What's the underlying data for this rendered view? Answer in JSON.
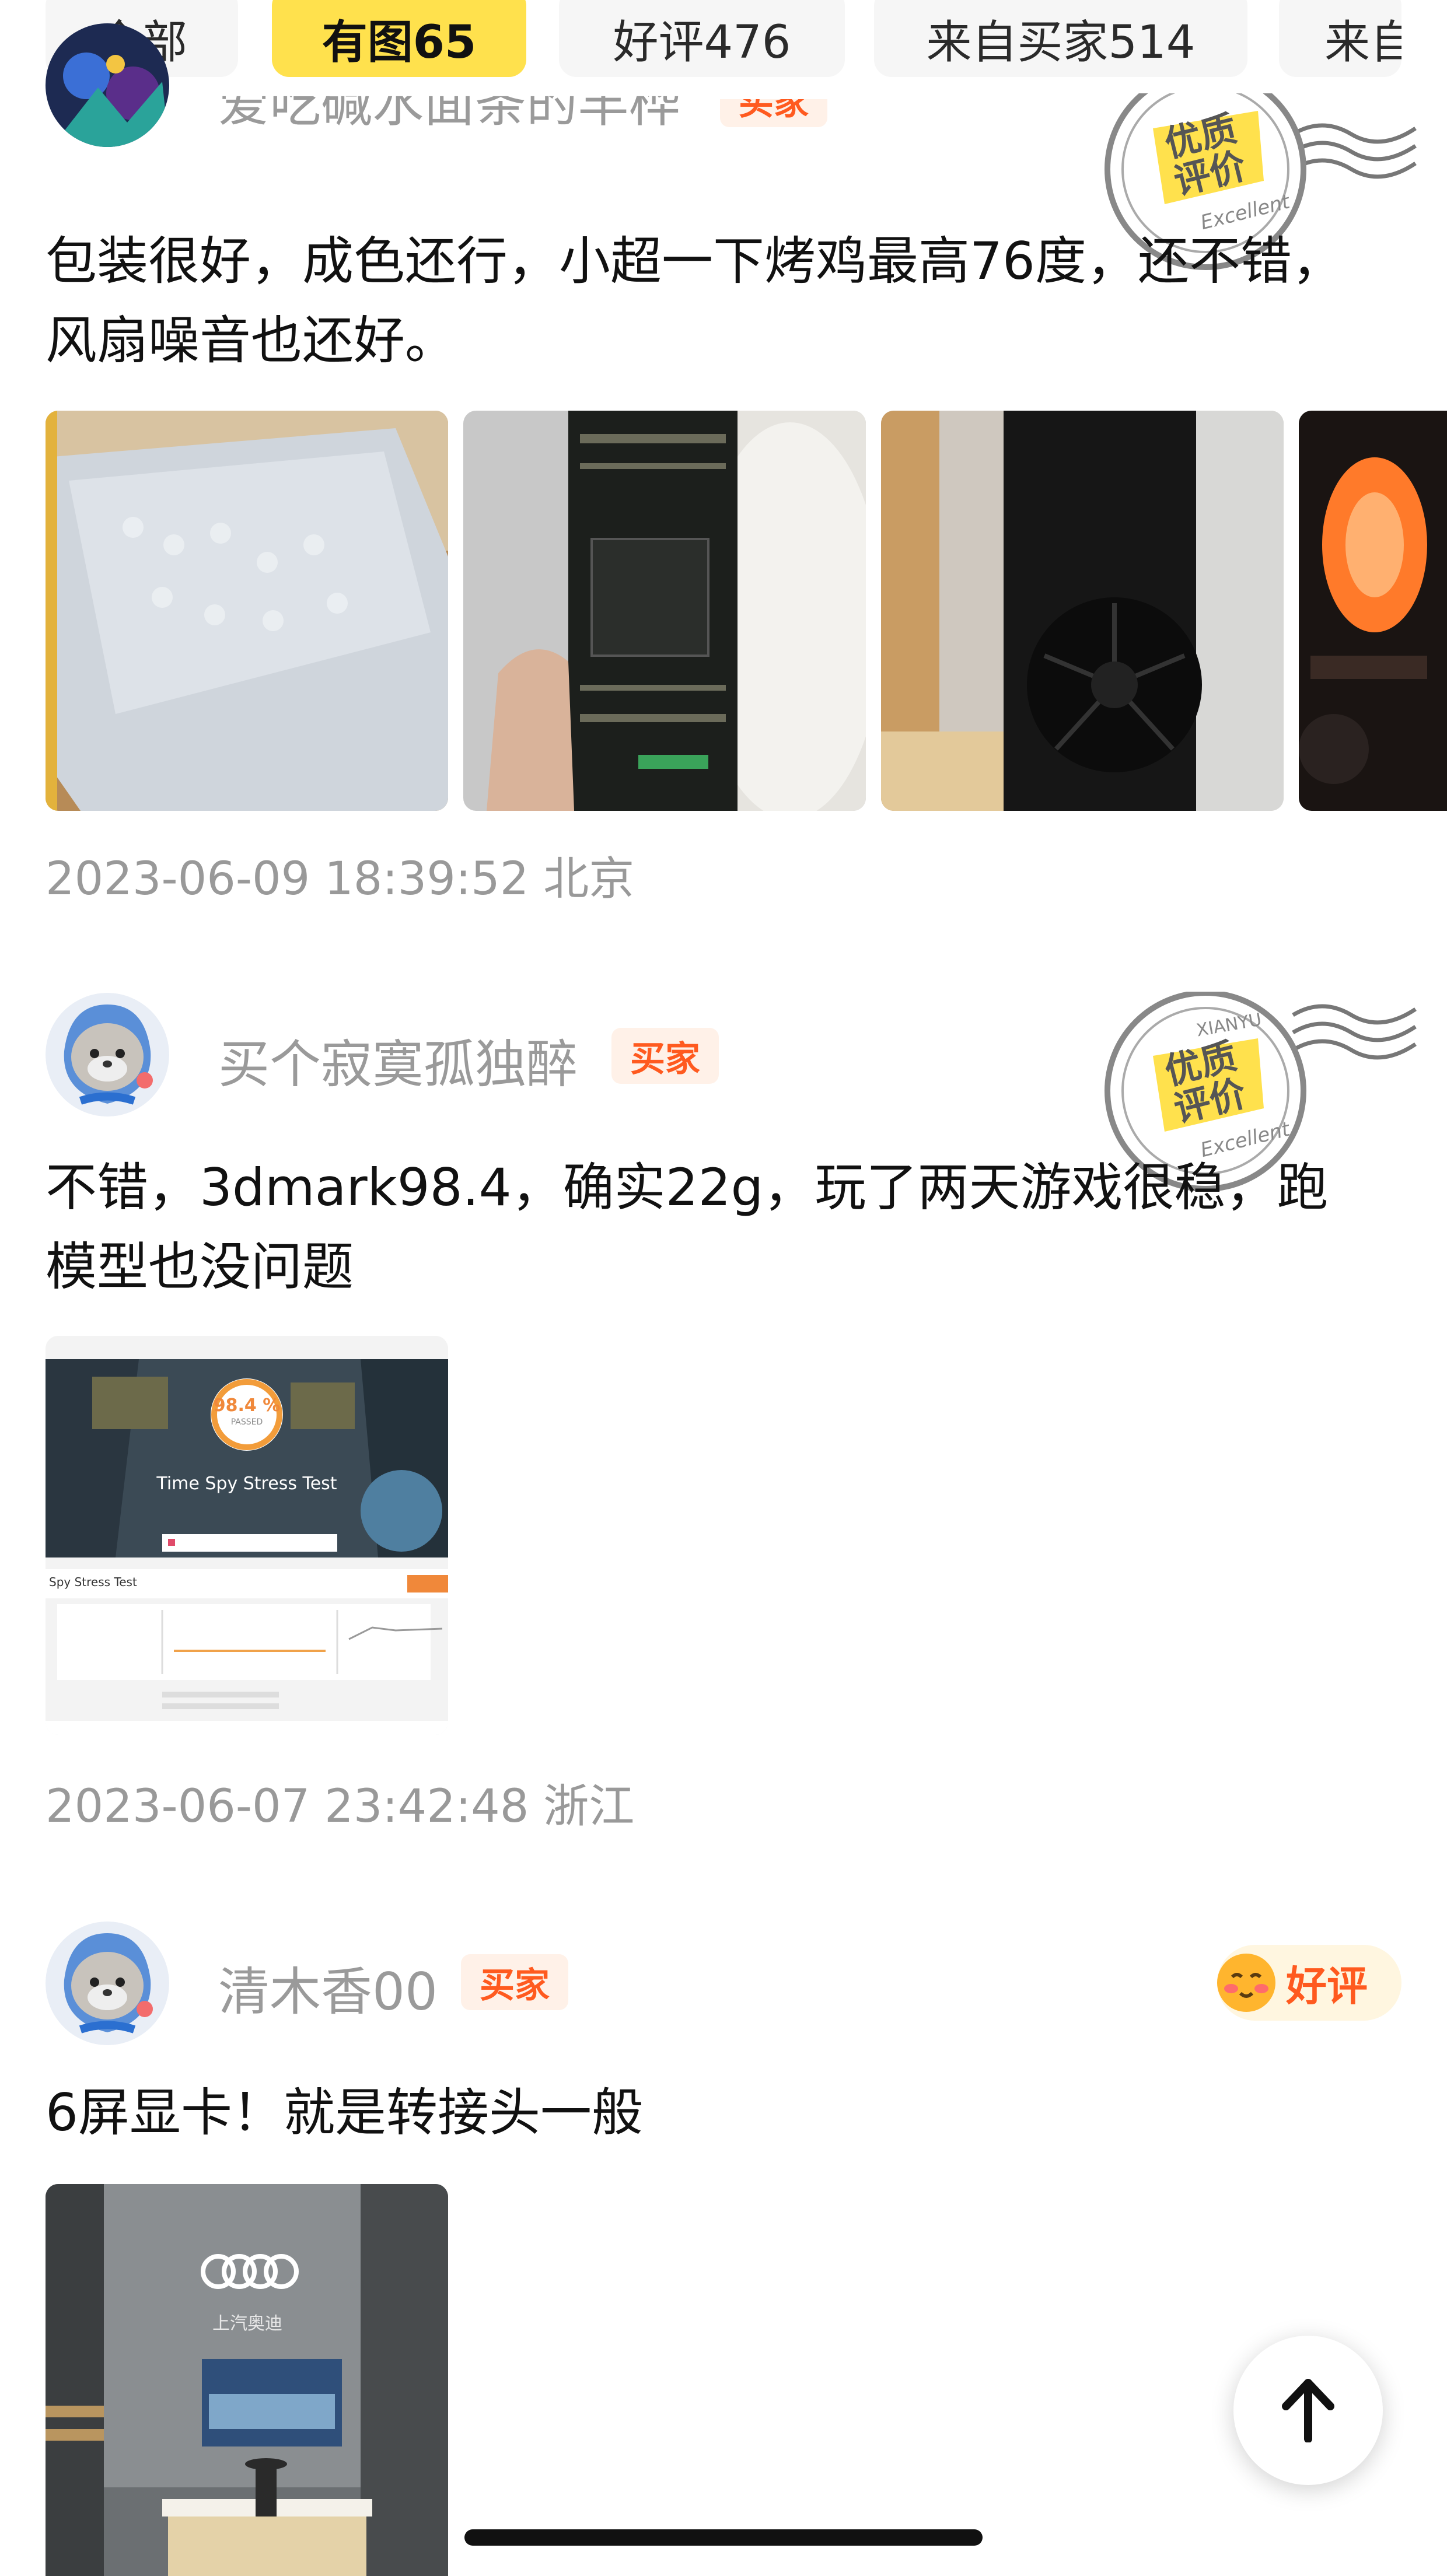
{
  "tabs": [
    {
      "label": "全部",
      "active": false
    },
    {
      "label": "有图65",
      "active": true
    },
    {
      "label": "好评476",
      "active": false
    },
    {
      "label": "来自买家514",
      "active": false
    },
    {
      "label": "来自",
      "active": false
    }
  ],
  "badges": {
    "buyer": "买家"
  },
  "stamp": {
    "top": "XIANYU",
    "line1": "优质",
    "line2": "评价",
    "bottom": "Excellent"
  },
  "reviews": [
    {
      "username": "爱吃碱水面条的羊桦",
      "text": "包装很好，成色还行，小超一下烤鸡最高76度，还不错，风扇噪音也还好。",
      "meta": "2023-06-09 18:39:52 北京"
    },
    {
      "username": "买个寂寞孤独醉",
      "text": "不错，3dmark98.4，确实22g，玩了两天游戏很稳，跑模型也没问题",
      "meta": "2023-06-07 23:42:48 浙江",
      "screenshot": {
        "percent": "98.4 %",
        "sub": "PASSED",
        "title": "Time Spy Stress Test",
        "tab": "Spy Stress Test"
      }
    },
    {
      "username": "清木香00",
      "rating_label": "好评",
      "text": "6屏显卡！就是转接头一般",
      "photo_caption": "上汽奥迪"
    }
  ],
  "icons": {
    "back_to_top": "arrow-up-icon",
    "smile": "smiling-emoji-icon"
  },
  "colors": {
    "accent": "#ffe14d",
    "badge_text": "#ff5a1f",
    "badge_bg": "#fff1e8",
    "muted": "#999999"
  }
}
